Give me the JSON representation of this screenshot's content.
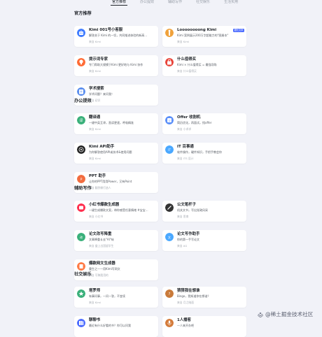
{
  "tabs": [
    "官方推荐",
    "办公提效",
    "辅助写作",
    "社交娱乐",
    "生活实用"
  ],
  "sections": [
    {
      "title": "官方推荐",
      "cards": [
        {
          "title": "Kimi 001号小客服",
          "desc": "解答关于 Kimi 的一切，共同推进体验的新高…",
          "source": "来自 Kimi",
          "icon": "robot-icon",
          "color": "#3f7bff"
        },
        {
          "title": "Loooooooong Kimi",
          "desc": "Kimi 案例展示200万字超能力的\"图册本\"",
          "source": "来自 Kimi",
          "icon": "giraffe-icon",
          "color": "#f0a23c",
          "badge": "超长文本"
        },
        {
          "title": "提示词专家",
          "desc": "专门帮助大规模于Kimi 更好地与 Kimi 协作",
          "source": "来自 Kimi",
          "icon": "lightbulb-icon",
          "color": "#ff6b35"
        },
        {
          "title": "什么值得买",
          "desc": "Kimi × 什么值得买 = 最强导购",
          "source": "来自 什么值得买",
          "icon": "shopping-icon",
          "color": "#e8443a"
        },
        {
          "title": "学术搜索",
          "desc": "学术问题？来问我！",
          "source": "来自 初识",
          "icon": "book-icon",
          "color": "#5a8dee"
        }
      ]
    },
    {
      "title": "办公提效",
      "cards": [
        {
          "title": "翻译通",
          "desc": "一键中英互译，直读更速，呼吸精准",
          "source": "来自 Kimi",
          "icon": "translate-icon",
          "color": "#3ab07a"
        },
        {
          "title": "Offer 收割机",
          "desc": "简历优化，再面试，找offer",
          "source": "来自 小求求",
          "icon": "offer-icon",
          "color": "#5b8ff9"
        },
        {
          "title": "Kimi API助手",
          "desc": "为你解答使用API或技术&使用问题",
          "source": "来自 Kimi",
          "icon": "api-icon",
          "color": "#222222"
        },
        {
          "title": "IT 百事通",
          "desc": "软件操作，硬件知识，手把手教会你",
          "source": "来自 ITS 设计",
          "icon": "it-icon",
          "color": "#4aa8ff"
        },
        {
          "title": "PPT 助手",
          "desc": "让你的PPT用用Power，又有Point",
          "source": "来自 翻到做打造人",
          "icon": "ppt-icon",
          "color": "#f26c3f"
        }
      ]
    },
    {
      "title": "辅助写作",
      "cards": [
        {
          "title": "小红书爆款生成器",
          "desc": "一键生成爆款文案，带你感受任意情绪 #宝宝…",
          "source": "来自 小红书",
          "icon": "xhs-icon",
          "color": "#ff2e4d"
        },
        {
          "title": "公文笔杆子",
          "desc": "机关文书，写出党政风采",
          "source": "来自 思南",
          "icon": "pen-icon",
          "color": "#333333"
        },
        {
          "title": "论文改写降重",
          "desc": "文章降重＆去\"AI\"味",
          "source": "来自 盛上出国留学生",
          "icon": "rewrite-icon",
          "color": "#3ab07a"
        },
        {
          "title": "论文写作助手",
          "desc": "你的第一手写论文",
          "source": "来自 AG",
          "icon": "essay-icon",
          "color": "#4aa8ff"
        },
        {
          "title": "爆款网文生成器",
          "desc": "重生之——用Kimi写网文",
          "source": "来自 写稿我用的",
          "icon": "novel-icon",
          "color": "#ff7a45"
        }
      ]
    },
    {
      "title": "社交娱乐",
      "cards": [
        {
          "title": "塔罗师",
          "desc": "有事问事，一问一答，不宜续",
          "source": "来自 Kimi",
          "icon": "tarot-icon",
          "color": "#3ab07a"
        },
        {
          "title": "猜猜我在想谁",
          "desc": "Bingo，我知道你在想谁？",
          "source": "来自 月之暗面",
          "icon": "guess-icon",
          "color": "#c97a3a"
        },
        {
          "title": "聊聊书",
          "desc": "最近有什么好看的书？你可以问我",
          "source": "",
          "icon": "books-icon",
          "color": "#4b6bff"
        },
        {
          "title": "1人播客",
          "desc": "一人来开办吧",
          "source": "",
          "icon": "podcast-icon",
          "color": "#d47b3a"
        }
      ]
    }
  ],
  "watermark": "@稀土掘金技术社区"
}
